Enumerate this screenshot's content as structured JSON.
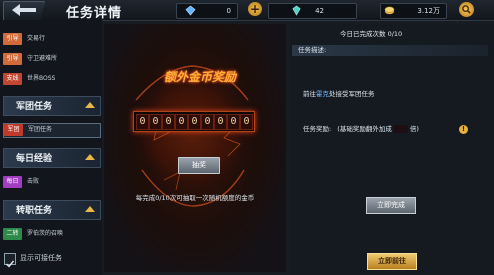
{
  "header": {
    "title": "任务详情"
  },
  "resources": {
    "diamond_blue": "0",
    "gem_teal": "42",
    "gold": "3.12万"
  },
  "sidebar": {
    "items_top": [
      {
        "tag": "引导",
        "tag_color": "#d26a3a",
        "label": "交易行"
      },
      {
        "tag": "引导",
        "tag_color": "#d26a3a",
        "label": "守卫避难所"
      },
      {
        "tag": "支线",
        "tag_color": "#c04832",
        "label": "世界BOSS"
      }
    ],
    "groups": [
      {
        "header": "军团任务",
        "item": {
          "tag": "军团",
          "tag_color": "#c03a2a",
          "label": "军团任务"
        }
      },
      {
        "header": "每日经验",
        "item": {
          "tag": "每日",
          "tag_color": "#a23cc0",
          "label": "击败"
        }
      },
      {
        "header": "转职任务",
        "item": {
          "tag": "二转",
          "tag_color": "#2e8a4a",
          "label": "罗伯茨的召唤"
        }
      }
    ],
    "show_possible_label": "显示可接任务"
  },
  "center": {
    "reward_title": "额外金币奖励",
    "digits": [
      "0",
      "0",
      "0",
      "0",
      "0",
      "0",
      "0",
      "0",
      "0"
    ],
    "draw_button": "抽奖",
    "description": "每完成0/10次可抽取一次随机额度的金币"
  },
  "right": {
    "daily_count": "今日已完成次数 0/10",
    "desc_title": "任务描述:",
    "task_prefix": "前往",
    "task_highlight": "霍克",
    "task_suffix": "处接受军团任务",
    "reward_title": "任务奖励:",
    "reward_note_prefix": "(基础奖励翻外加成",
    "reward_note_suffix": "倍)",
    "finish_now_button": "立即完成",
    "go_now_button": "立即前往"
  }
}
